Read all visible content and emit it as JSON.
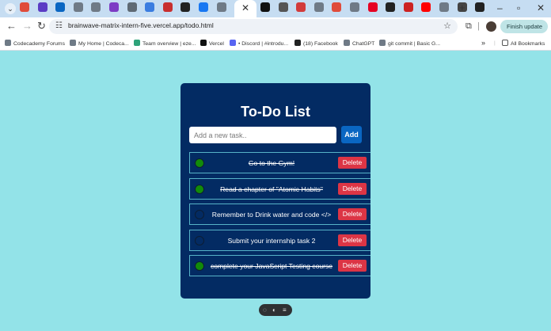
{
  "browser": {
    "tab_icon_colors": [
      "#e04b3a",
      "#5b3cc4",
      "#0a66c2",
      "#6f7a86",
      "#6f7a86",
      "#7d3cc4",
      "#5f6a74",
      "#3b7de0",
      "#c82f2f",
      "#222222",
      "#1877f2",
      "#6f7a86",
      "#111111",
      "#555555",
      "#d23b3b",
      "#6f7a86",
      "#e04b3a",
      "#6f7a86",
      "#e60023",
      "#222222",
      "#cc2222",
      "#ff0000",
      "#6f7a86",
      "#444444",
      "#222222"
    ],
    "close_tab_glyph": "✕",
    "address": "brainwave-matrix-intern-five.vercel.app/todo.html",
    "finish_update_label": "Finish update",
    "bookmarks": [
      {
        "label": "Codecademy Forums",
        "icon_color": "#6f7a86"
      },
      {
        "label": "My Home | Codeca...",
        "icon_color": "#6f7a86"
      },
      {
        "label": "Team overview | eze...",
        "icon_color": "#2fa37a"
      },
      {
        "label": "Vercel",
        "icon_color": "#111111"
      },
      {
        "label": "• Discord | #introdu...",
        "icon_color": "#5865f2"
      },
      {
        "label": "(18) Facebook",
        "icon_color": "#222222"
      },
      {
        "label": "ChatGPT",
        "icon_color": "#6f7a86"
      },
      {
        "label": "git commit | Basic G...",
        "icon_color": "#6f7a86"
      }
    ],
    "more_bookmarks_glyph": "»",
    "all_bookmarks_label": "All Bookmarks"
  },
  "app": {
    "title": "To-Do List",
    "input_placeholder": "Add a new task..",
    "add_label": "Add",
    "delete_label": "Delete",
    "tasks": [
      {
        "text": "Go to the Gym!",
        "done": true
      },
      {
        "text": "Read a chapter of \"Atomic Habits\"",
        "done": true
      },
      {
        "text": "Remember to Drink water and code </>",
        "done": false
      },
      {
        "text": "Submit your internship task 2",
        "done": false
      },
      {
        "text": "complete your JavaScript Testing course",
        "done": true
      }
    ],
    "colors": {
      "page_bg": "#93e3e8",
      "card_bg": "#032b63",
      "done_circle": "#128b0a",
      "delete_bg": "#dc3545",
      "add_bg": "#0a66c2"
    }
  }
}
